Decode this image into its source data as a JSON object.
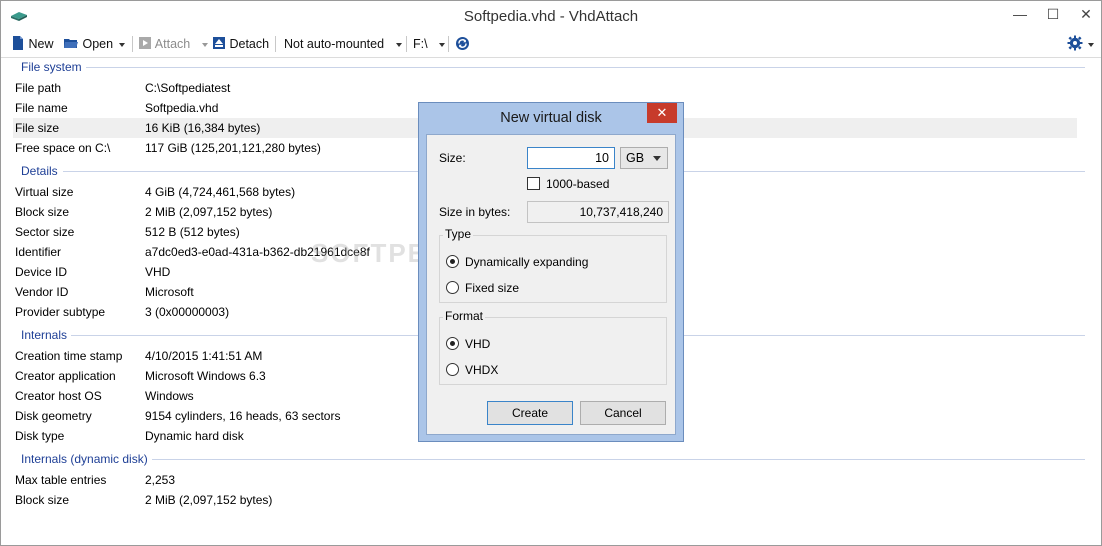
{
  "window": {
    "title": "Softpedia.vhd - VhdAttach",
    "minimize": "—",
    "maximize": "☐",
    "close": "✕"
  },
  "toolbar": {
    "new": "New",
    "open": "Open",
    "attach": "Attach",
    "detach": "Detach",
    "automount": "Not auto-mounted",
    "drive": "F:\\"
  },
  "sections": [
    {
      "title": "File system",
      "rows": [
        {
          "key": "File path",
          "value": "C:\\Softpediatest"
        },
        {
          "key": "File name",
          "value": "Softpedia.vhd"
        },
        {
          "key": "File size",
          "value": "16 KiB (16,384 bytes)"
        },
        {
          "key": "Free space on C:\\",
          "value": "117 GiB (125,201,121,280 bytes)"
        }
      ]
    },
    {
      "title": "Details",
      "rows": [
        {
          "key": "Virtual size",
          "value": "4 GiB (4,724,461,568 bytes)"
        },
        {
          "key": "Block size",
          "value": "2 MiB (2,097,152 bytes)"
        },
        {
          "key": "Sector size",
          "value": "512 B (512 bytes)"
        },
        {
          "key": "Identifier",
          "value": "a7dc0ed3-e0ad-431a-b362-db21961dce8f"
        },
        {
          "key": "Device ID",
          "value": "VHD"
        },
        {
          "key": "Vendor ID",
          "value": "Microsoft"
        },
        {
          "key": "Provider subtype",
          "value": "3 (0x00000003)"
        }
      ]
    },
    {
      "title": "Internals",
      "rows": [
        {
          "key": "Creation time stamp",
          "value": "4/10/2015 1:41:51 AM"
        },
        {
          "key": "Creator application",
          "value": "Microsoft Windows 6.3"
        },
        {
          "key": "Creator host OS",
          "value": "Windows"
        },
        {
          "key": "Disk geometry",
          "value": "9154 cylinders, 16 heads, 63 sectors"
        },
        {
          "key": "Disk type",
          "value": "Dynamic hard disk"
        }
      ]
    },
    {
      "title": "Internals (dynamic disk)",
      "rows": [
        {
          "key": "Max table entries",
          "value": "2,253"
        },
        {
          "key": "Block size",
          "value": "2 MiB (2,097,152 bytes)"
        }
      ]
    }
  ],
  "watermark": "SOFTPEDIA®",
  "dialog": {
    "title": "New virtual disk",
    "close": "✕",
    "size_label": "Size:",
    "size_value": "10",
    "size_unit": "GB",
    "checkbox_label": "1000-based",
    "checkbox_checked": false,
    "bytes_label": "Size in bytes:",
    "bytes_value": "10,737,418,240",
    "type_legend": "Type",
    "type_options": [
      "Dynamically expanding",
      "Fixed size"
    ],
    "type_selected": "Dynamically expanding",
    "format_legend": "Format",
    "format_options": [
      "VHD",
      "VHDX"
    ],
    "format_selected": "VHD",
    "create": "Create",
    "cancel": "Cancel"
  }
}
